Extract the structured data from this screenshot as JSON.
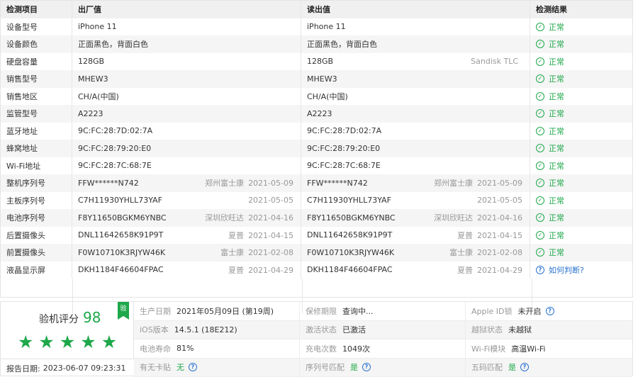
{
  "table": {
    "headers": [
      "检测项目",
      "出厂值",
      "读出值",
      "检测结果"
    ],
    "rows": [
      {
        "item": "设备型号",
        "factory": "iPhone 11",
        "factory_note": "",
        "factory_date": "",
        "read": "iPhone 11",
        "read_note": "",
        "read_date": "",
        "result": "正常",
        "result_type": "ok"
      },
      {
        "item": "设备颜色",
        "factory": "正面黑色，背面白色",
        "factory_note": "",
        "factory_date": "",
        "read": "正面黑色，背面白色",
        "read_note": "",
        "read_date": "",
        "result": "正常",
        "result_type": "ok"
      },
      {
        "item": "硬盘容量",
        "factory": "128GB",
        "factory_note": "",
        "factory_date": "",
        "read": "128GB",
        "read_note": "Sandisk TLC",
        "read_date": "",
        "result": "正常",
        "result_type": "ok"
      },
      {
        "item": "销售型号",
        "factory": "MHEW3",
        "factory_note": "",
        "factory_date": "",
        "read": "MHEW3",
        "read_note": "",
        "read_date": "",
        "result": "正常",
        "result_type": "ok"
      },
      {
        "item": "销售地区",
        "factory": "CH/A(中国)",
        "factory_note": "",
        "factory_date": "",
        "read": "CH/A(中国)",
        "read_note": "",
        "read_date": "",
        "result": "正常",
        "result_type": "ok"
      },
      {
        "item": "监管型号",
        "factory": "A2223",
        "factory_note": "",
        "factory_date": "",
        "read": "A2223",
        "read_note": "",
        "read_date": "",
        "result": "正常",
        "result_type": "ok"
      },
      {
        "item": "蓝牙地址",
        "factory": "9C:FC:28:7D:02:7A",
        "factory_note": "",
        "factory_date": "",
        "read": "9C:FC:28:7D:02:7A",
        "read_note": "",
        "read_date": "",
        "result": "正常",
        "result_type": "ok"
      },
      {
        "item": "蜂窝地址",
        "factory": "9C:FC:28:79:20:E0",
        "factory_note": "",
        "factory_date": "",
        "read": "9C:FC:28:79:20:E0",
        "read_note": "",
        "read_date": "",
        "result": "正常",
        "result_type": "ok"
      },
      {
        "item": "Wi-Fi地址",
        "factory": "9C:FC:28:7C:68:7E",
        "factory_note": "",
        "factory_date": "",
        "read": "9C:FC:28:7C:68:7E",
        "read_note": "",
        "read_date": "",
        "result": "正常",
        "result_type": "ok"
      },
      {
        "item": "整机序列号",
        "factory": "FFW******N742",
        "factory_note": "郑州富士康",
        "factory_date": "2021-05-09",
        "read": "FFW******N742",
        "read_note": "郑州富士康",
        "read_date": "2021-05-09",
        "result": "正常",
        "result_type": "ok"
      },
      {
        "item": "主板序列号",
        "factory": "C7H11930YHLL73YAF",
        "factory_note": "",
        "factory_date": "2021-05-05",
        "read": "C7H11930YHLL73YAF",
        "read_note": "",
        "read_date": "2021-05-05",
        "result": "正常",
        "result_type": "ok"
      },
      {
        "item": "电池序列号",
        "factory": "F8Y11650BGKM6YNBC",
        "factory_note": "深圳欣旺达",
        "factory_date": "2021-04-16",
        "read": "F8Y11650BGKM6YNBC",
        "read_note": "深圳欣旺达",
        "read_date": "2021-04-16",
        "result": "正常",
        "result_type": "ok"
      },
      {
        "item": "后置摄像头",
        "factory": "DNL11642658K91P9T",
        "factory_note": "夏普",
        "factory_date": "2021-04-15",
        "read": "DNL11642658K91P9T",
        "read_note": "夏普",
        "read_date": "2021-04-15",
        "result": "正常",
        "result_type": "ok"
      },
      {
        "item": "前置摄像头",
        "factory": "F0W10710K3RJYW46K",
        "factory_note": "富士康",
        "factory_date": "2021-02-08",
        "read": "F0W10710K3RJYW46K",
        "read_note": "富士康",
        "read_date": "2021-02-08",
        "result": "正常",
        "result_type": "ok"
      },
      {
        "item": "液晶显示屏",
        "factory": "DKH1184F46604FPAC",
        "factory_note": "夏普",
        "factory_date": "2021-04-29",
        "read": "DKH1184F46604FPAC",
        "read_note": "夏普",
        "read_date": "2021-04-29",
        "result": "如何判断?",
        "result_type": "help"
      }
    ]
  },
  "summary": {
    "score_label": "验机评分",
    "score_value": "98",
    "stars": 5,
    "badge": "验",
    "report_date_label": "报告日期:",
    "report_date": "2023-06-07 09:23:31",
    "grid": [
      [
        {
          "label": "生产日期",
          "value": "2021年05月09日 (第19周)",
          "style": "",
          "help": false
        },
        {
          "label": "保修期限",
          "value": "查询中...",
          "style": "",
          "help": false
        },
        {
          "label": "Apple ID锁",
          "value": "未开启",
          "style": "",
          "help": true
        }
      ],
      [
        {
          "label": "iOS版本",
          "value": "14.5.1 (18E212)",
          "style": "",
          "help": false
        },
        {
          "label": "激活状态",
          "value": "已激活",
          "style": "",
          "help": false
        },
        {
          "label": "越狱状态",
          "value": "未越狱",
          "style": "",
          "help": false
        }
      ],
      [
        {
          "label": "电池寿命",
          "value": "81%",
          "style": "",
          "help": false
        },
        {
          "label": "充电次数",
          "value": "1049次",
          "style": "",
          "help": false
        },
        {
          "label": "Wi-Fi模块",
          "value": "高温Wi-Fi",
          "style": "",
          "help": false
        }
      ],
      [
        {
          "label": "有无卡贴",
          "value": "无",
          "style": "green",
          "help": true
        },
        {
          "label": "序列号匹配",
          "value": "是",
          "style": "green",
          "help": true
        },
        {
          "label": "五码匹配",
          "value": "是",
          "style": "green",
          "help": true
        }
      ]
    ]
  },
  "icons": {
    "ok": "check-circle-icon",
    "help": "question-circle-icon",
    "star": "star-icon"
  },
  "colors": {
    "ok": "#1ea84a",
    "link": "#2a74d1",
    "muted": "#999999"
  }
}
